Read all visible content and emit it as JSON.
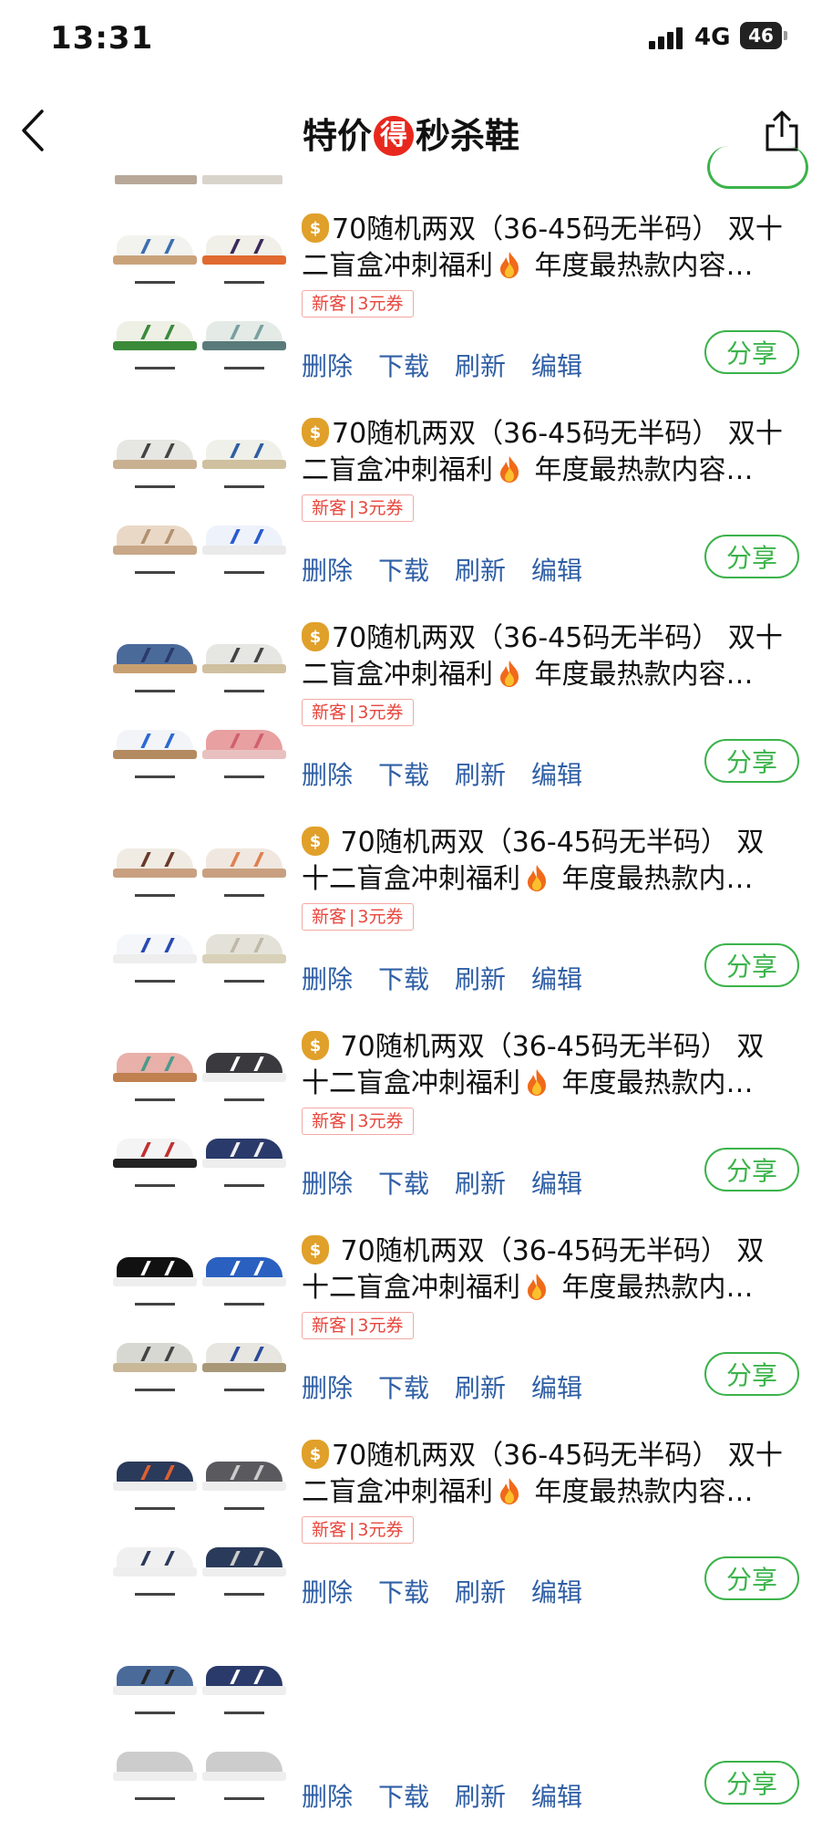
{
  "status_bar": {
    "time": "13:31",
    "network": "4G",
    "battery": "46"
  },
  "nav": {
    "title_left": "特价",
    "title_badge": "得",
    "title_right": "秒杀鞋"
  },
  "items": [
    {
      "title_line1": "70随机两双（36-45码无半码） 双十",
      "title_line2": "二盲盒冲刺福利",
      "title_line2_tail": " 年度最热款内容…",
      "coupon_a": "新客",
      "coupon_b": "3元券",
      "share": "分享"
    },
    {
      "title_line1": "70随机两双（36-45码无半码） 双十",
      "title_line2": "二盲盒冲刺福利",
      "title_line2_tail": " 年度最热款内容…",
      "coupon_a": "新客",
      "coupon_b": "3元券",
      "share": "分享"
    },
    {
      "title_line1": "70随机两双（36-45码无半码） 双十",
      "title_line2": "二盲盒冲刺福利",
      "title_line2_tail": " 年度最热款内容…",
      "coupon_a": "新客",
      "coupon_b": "3元券",
      "share": "分享"
    },
    {
      "title_line1": " 70随机两双（36-45码无半码） 双",
      "title_line2": "十二盲盒冲刺福利",
      "title_line2_tail": " 年度最热款内…",
      "coupon_a": "新客",
      "coupon_b": "3元券",
      "share": "分享"
    },
    {
      "title_line1": " 70随机两双（36-45码无半码） 双",
      "title_line2": "十二盲盒冲刺福利",
      "title_line2_tail": " 年度最热款内…",
      "coupon_a": "新客",
      "coupon_b": "3元券",
      "share": "分享"
    },
    {
      "title_line1": " 70随机两双（36-45码无半码） 双",
      "title_line2": "十二盲盒冲刺福利",
      "title_line2_tail": " 年度最热款内…",
      "coupon_a": "新客",
      "coupon_b": "3元券",
      "share": "分享"
    },
    {
      "title_line1": "70随机两双（36-45码无半码） 双十",
      "title_line2": "二盲盒冲刺福利",
      "title_line2_tail": " 年度最热款内容…",
      "coupon_a": "新客",
      "coupon_b": "3元券",
      "share": "分享"
    },
    {
      "title_line1": "",
      "title_line2": "",
      "title_line2_tail": "",
      "coupon_a": "",
      "coupon_b": "",
      "share": "分享"
    }
  ],
  "actions": {
    "delete": "删除",
    "download": "下载",
    "refresh": "刷新",
    "edit": "编辑"
  },
  "icons": {
    "back": "chevron-left-icon",
    "share_top": "share-icon",
    "money": "money-bag-icon",
    "fire": "fire-icon"
  },
  "colors": {
    "accent_green": "#3bb34a",
    "action_blue": "#2f5fa5",
    "coupon_red": "#e8463c",
    "badge_red": "#e8281e"
  }
}
